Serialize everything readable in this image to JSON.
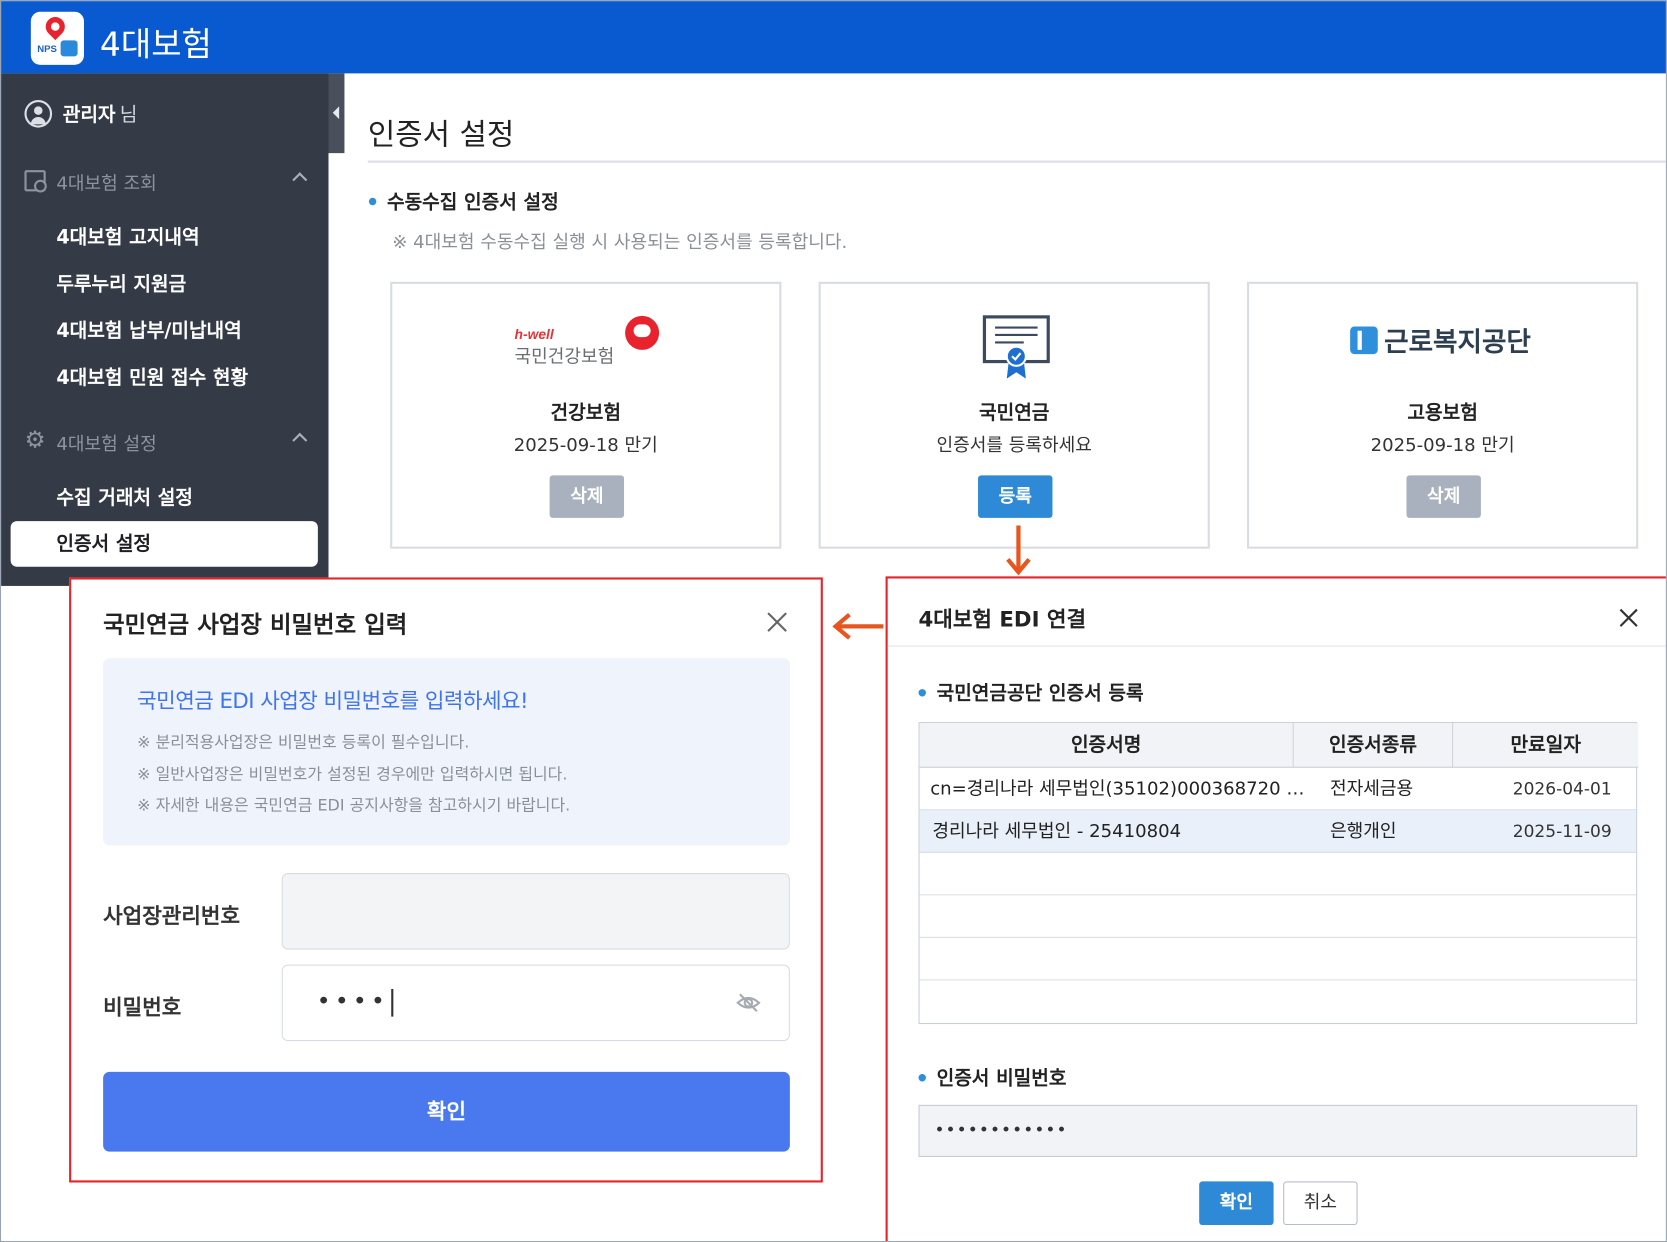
{
  "app": {
    "title": "4대보험"
  },
  "sidebar": {
    "user_name": "관리자",
    "user_suffix": "님",
    "groups": [
      {
        "label": "4대보험 조회",
        "items": [
          "4대보험 고지내역",
          "두루누리 지원금",
          "4대보험 납부/미납내역",
          "4대보험 민원 접수 현황"
        ]
      },
      {
        "label": "4대보험 설정",
        "items": [
          "수집 거래처 설정",
          "인증서 설정"
        ]
      }
    ],
    "active_item": "인증서 설정"
  },
  "main": {
    "title": "인증서 설정",
    "section_title": "수동수집 인증서 설정",
    "section_note": "※ 4대보험 수동수집 실행 시 사용되는 인증서를 등록합니다.",
    "cards": [
      {
        "logo": "hwell-logo",
        "logo_small": "h-well",
        "logo_text": "국민건강보험",
        "name": "건강보험",
        "status": "2025-09-18 만기",
        "button": "삭제"
      },
      {
        "logo": "certificate-icon",
        "name": "국민연금",
        "status": "인증서를 등록하세요",
        "button": "등록"
      },
      {
        "logo": "kcomwel-logo",
        "logo_text": "근로복지공단",
        "name": "고용보험",
        "status": "2025-09-18 만기",
        "button": "삭제"
      }
    ]
  },
  "nps_modal": {
    "title": "국민연금 사업장 비밀번호 입력",
    "info_head": "국민연금 EDI 사업장 비밀번호를 입력하세요!",
    "info_lines": [
      "※ 분리적용사업장은 비밀번호 등록이 필수입니다.",
      "※ 일반사업장은 비밀번호가 설정된 경우에만 입력하시면 됩니다.",
      "※ 자세한 내용은 국민연금 EDI 공지사항을 참고하시기 바랍니다."
    ],
    "business_no_label": "사업장관리번호",
    "business_no_value": "",
    "password_label": "비밀번호",
    "password_value": "••••",
    "confirm": "확인"
  },
  "edi_modal": {
    "title": "4대보험 EDI 연결",
    "section_title": "국민연금공단 인증서 등록",
    "columns": [
      "인증서명",
      "인증서종류",
      "만료일자"
    ],
    "rows": [
      {
        "name": "cn=경리나라 세무법인(35102)000368720 …",
        "type": "전자세금용",
        "expiry": "2026-04-01"
      },
      {
        "name": "경리나라 세무법인 - 25410804",
        "type": "은행개인",
        "expiry": "2025-11-09"
      }
    ],
    "password_title": "인증서 비밀번호",
    "password_value": "••••••••••••",
    "confirm": "확인",
    "cancel": "취소"
  },
  "colors": {
    "brand": "#0959d0",
    "sidebar": "#353b46",
    "primary": "#2e8ad6",
    "highlight": "#e4262b",
    "arrow": "#e8561f"
  }
}
